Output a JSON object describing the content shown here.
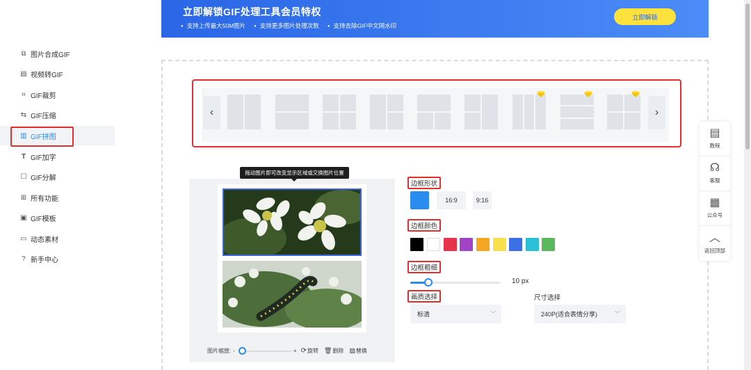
{
  "sidebar": {
    "items": [
      {
        "icon": "layers-icon",
        "label": "图片合成GIF",
        "active": false
      },
      {
        "icon": "video-icon",
        "label": "视频转GIF",
        "active": false
      },
      {
        "icon": "crop-icon",
        "label": "GIF裁剪",
        "active": false
      },
      {
        "icon": "compress-icon",
        "label": "GIF压缩",
        "active": false
      },
      {
        "icon": "grid-icon",
        "label": "GIF拼图",
        "active": true
      },
      {
        "icon": "text-icon",
        "label": "GIF加字",
        "active": false
      },
      {
        "icon": "split-icon",
        "label": "GIF分解",
        "active": false
      },
      {
        "icon": "apps-icon",
        "label": "所有功能",
        "active": false
      },
      {
        "icon": "template-icon",
        "label": "GIF模板",
        "active": false
      },
      {
        "icon": "folder-icon",
        "label": "动态素材",
        "active": false
      },
      {
        "icon": "help-circle-icon",
        "label": "新手中心",
        "active": false
      }
    ]
  },
  "banner": {
    "title": "立即解锁GIF处理工具会员特权",
    "features": [
      "支持上传最大50M图片",
      "支持更多图片处理次数",
      "支持去除GIF中文网水印"
    ],
    "unlock_label": "立即解锁"
  },
  "templates": {
    "prev_label": "‹",
    "next_label": "›",
    "count": 9,
    "premium": [
      false,
      false,
      false,
      false,
      false,
      false,
      true,
      true,
      true
    ]
  },
  "preview": {
    "tooltip": "拖动图片即可改变显示区域或交换图片位置",
    "zoom_label": "图片缩放:",
    "zoom_minus": "-",
    "zoom_plus": "+",
    "rotate_label": "旋转",
    "delete_label": "删除",
    "replace_label": "替换"
  },
  "settings": {
    "border_shape_label": "边框形状",
    "ratio_options": [
      "16:9",
      "9:16"
    ],
    "border_color_label": "边框颜色",
    "colors": [
      "#000000",
      "#ffffff",
      "#e8334d",
      "#a144c6",
      "#f5a623",
      "#f8e04a",
      "#3c6fe6",
      "#2bc0d6",
      "#5cb85c"
    ],
    "border_width_label": "边框粗细",
    "border_width_value": "10 px",
    "quality_label": "画质选择",
    "quality_value": "标清",
    "size_label": "尺寸选择",
    "size_value": "240P(适合表情分享)"
  },
  "tools": [
    {
      "icon": "document-icon",
      "label": "教程"
    },
    {
      "icon": "headset-icon",
      "label": "客服"
    },
    {
      "icon": "qrcode-icon",
      "label": "公众号"
    },
    {
      "icon": "chevron-up-icon",
      "label": "返回顶部"
    }
  ]
}
